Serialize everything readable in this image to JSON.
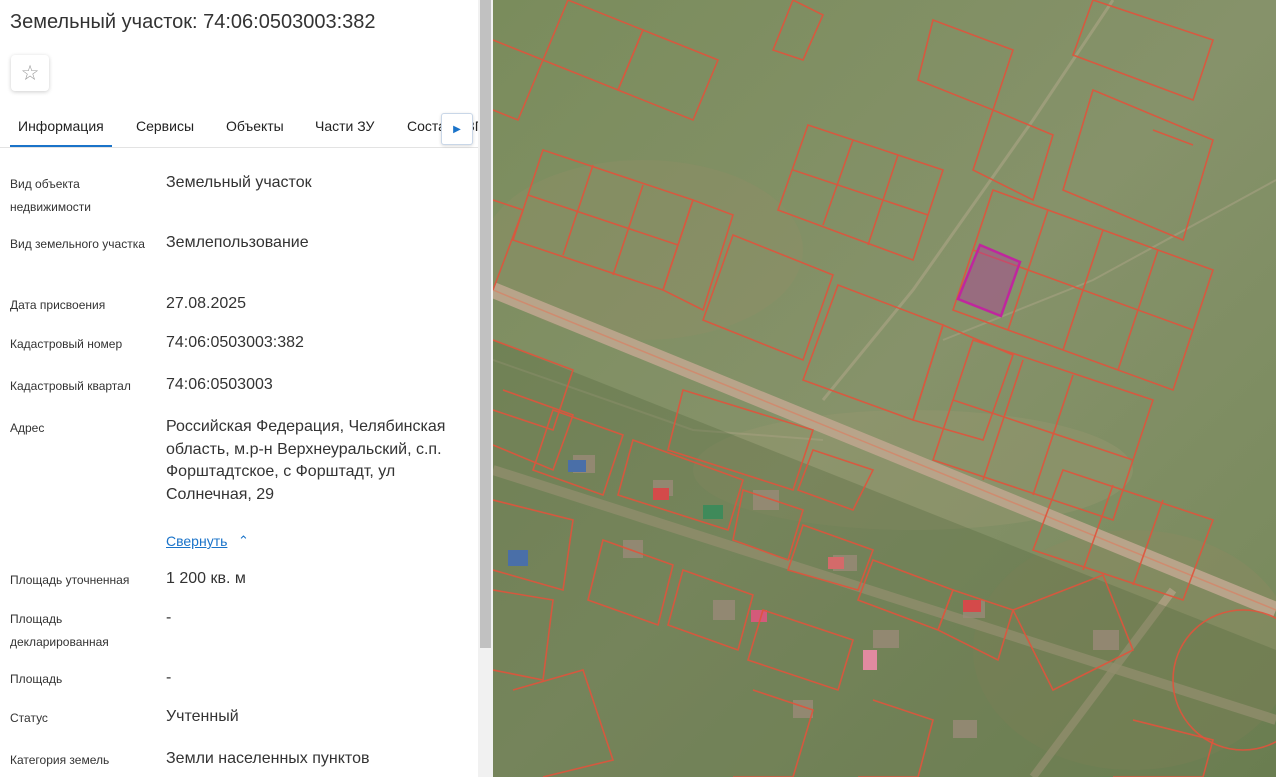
{
  "header": {
    "title": "Земельный участок: 74:06:0503003:382",
    "favorite_icon": "star-icon"
  },
  "tabs": [
    {
      "label": "Информация",
      "active": true
    },
    {
      "label": "Сервисы",
      "active": false
    },
    {
      "label": "Объекты",
      "active": false
    },
    {
      "label": "Части ЗУ",
      "active": false
    },
    {
      "label": "Состав ЕЗП",
      "active": false
    }
  ],
  "tabs_scroll_icon": "chevron-right-icon",
  "info": [
    {
      "label": "Вид объекта недвижимости",
      "value": "Земельный участок"
    },
    {
      "label": "Вид земельного участка",
      "value": "Землепользование"
    },
    {
      "label": "Дата присвоения",
      "value": "27.08.2025"
    },
    {
      "label": "Кадастровый номер",
      "value": "74:06:0503003:382"
    },
    {
      "label": "Кадастровый квартал",
      "value": "74:06:0503003"
    },
    {
      "label": "Адрес",
      "value": "Российская Федерация, Челябинская область, м.р-н Верхнеуральский, с.п. Форштадтское, с Форштадт, ул Солнечная, 29"
    },
    {
      "label": "Площадь уточненная",
      "value": "1 200 кв. м"
    },
    {
      "label": "Площадь декларированная",
      "value": "-"
    },
    {
      "label": "Площадь",
      "value": "-"
    },
    {
      "label": "Статус",
      "value": "Учтенный"
    },
    {
      "label": "Категория земель",
      "value": "Земли населенных пунктов"
    }
  ],
  "address_toggle": {
    "label": "Свернуть",
    "icon": "chevron-up-icon"
  },
  "colors": {
    "accent": "#1a73c9",
    "parcel_outline": "#e0543c",
    "selected_parcel": "#c0269e",
    "terrain": "#7f8f5f"
  }
}
